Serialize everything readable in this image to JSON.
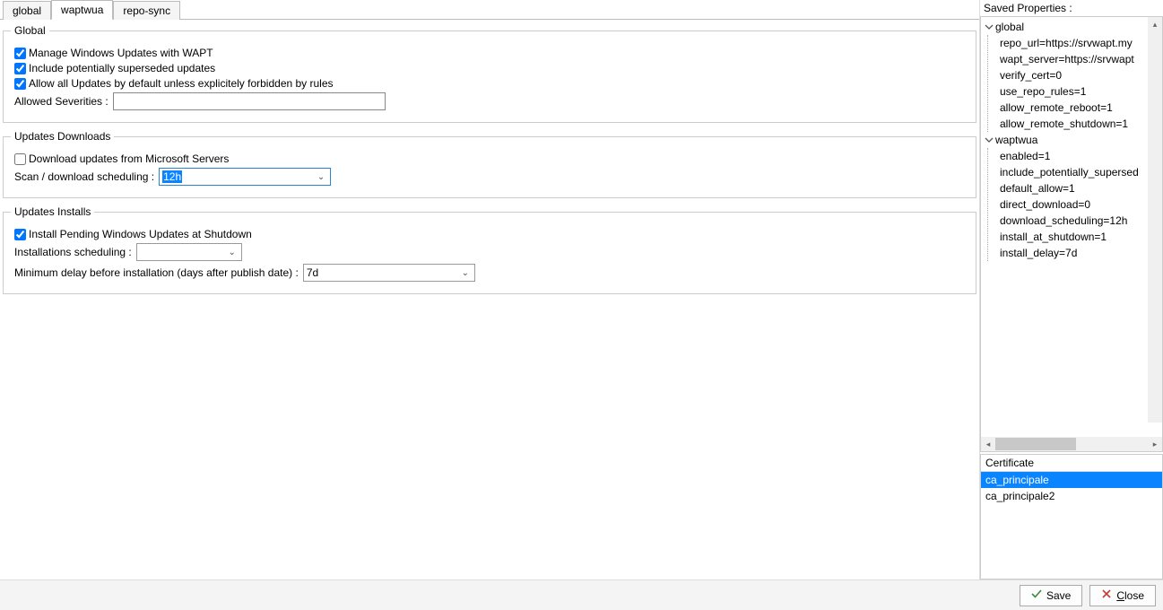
{
  "tabs": {
    "global": "global",
    "waptwua": "waptwua",
    "reposync": "repo-sync"
  },
  "group_global": {
    "legend": "Global",
    "manage_label": "Manage Windows Updates with WAPT",
    "include_label": "Include potentially superseded updates",
    "allowall_label": "Allow all Updates by default unless explicitely forbidden by rules",
    "allowed_sev_label": "Allowed Severities :"
  },
  "group_downloads": {
    "legend": "Updates Downloads",
    "download_ms_label": "Download updates from Microsoft Servers",
    "scan_label": "Scan / download scheduling :",
    "scan_value": "12h"
  },
  "group_installs": {
    "legend": "Updates Installs",
    "install_shutdown_label": "Install Pending Windows Updates at Shutdown",
    "install_sched_label": "Installations scheduling :",
    "install_sched_value": "",
    "min_delay_label": "Minimum delay before installation (days after publish date) :",
    "min_delay_value": "7d"
  },
  "saved_props": {
    "title": "Saved Properties :",
    "global_label": "global",
    "global_items": [
      "repo_url=https://srvwapt.my",
      "wapt_server=https://srvwapt",
      "verify_cert=0",
      "use_repo_rules=1",
      "allow_remote_reboot=1",
      "allow_remote_shutdown=1"
    ],
    "waptwua_label": "waptwua",
    "waptwua_items": [
      "enabled=1",
      "include_potentially_supersed",
      "default_allow=1",
      "direct_download=0",
      "download_scheduling=12h",
      "install_at_shutdown=1",
      "install_delay=7d"
    ]
  },
  "certificates": {
    "header": "Certificate",
    "items": [
      "ca_principale",
      "ca_principale2"
    ]
  },
  "buttons": {
    "save": "Save",
    "close": "Close"
  }
}
